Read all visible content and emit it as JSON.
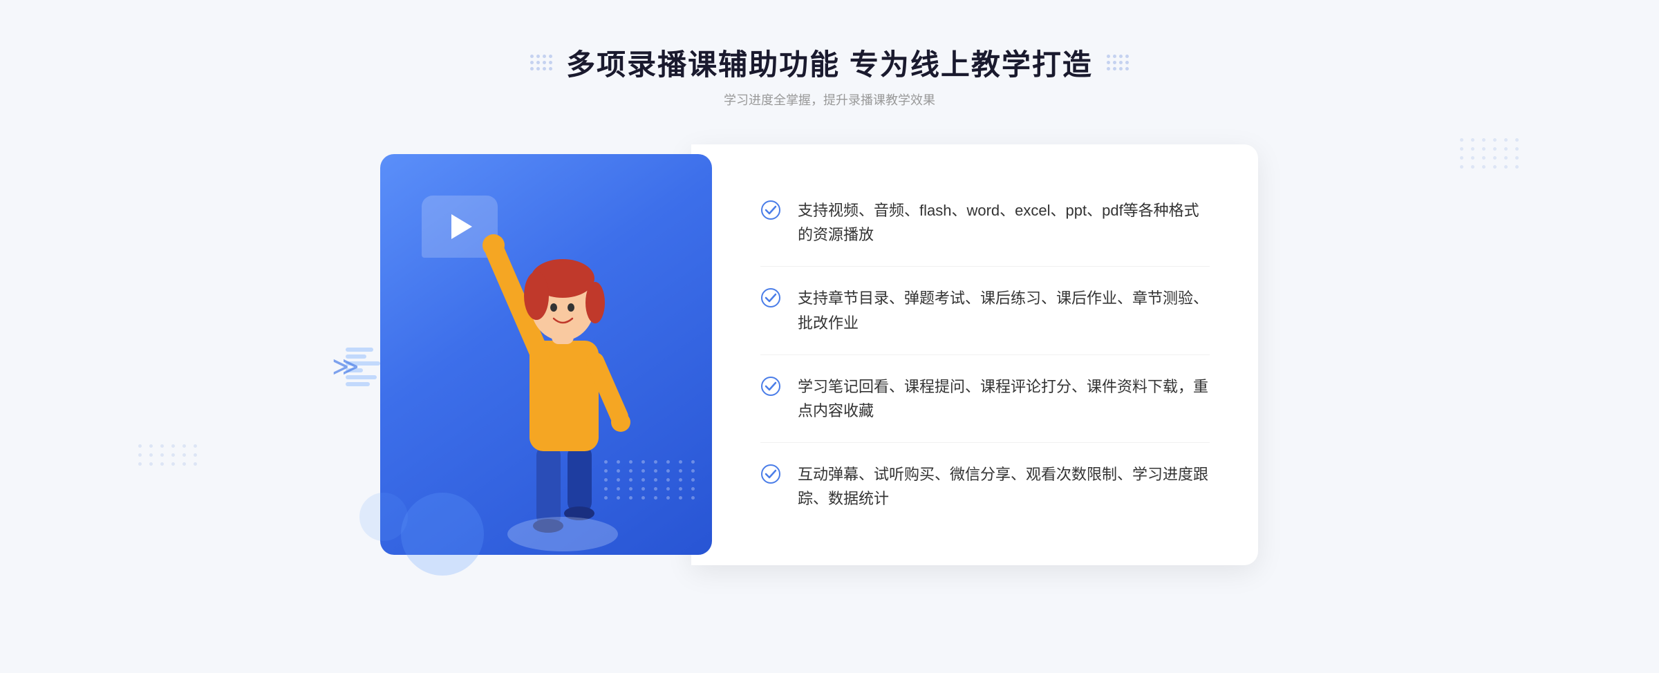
{
  "header": {
    "title": "多项录播课辅助功能 专为线上教学打造",
    "subtitle": "学习进度全掌握，提升录播课教学效果"
  },
  "features": [
    {
      "id": 1,
      "text": "支持视频、音频、flash、word、excel、ppt、pdf等各种格式的资源播放"
    },
    {
      "id": 2,
      "text": "支持章节目录、弹题考试、课后练习、课后作业、章节测验、批改作业"
    },
    {
      "id": 3,
      "text": "学习笔记回看、课程提问、课程评论打分、课件资料下载，重点内容收藏"
    },
    {
      "id": 4,
      "text": "互动弹幕、试听购买、微信分享、观看次数限制、学习进度跟踪、数据统计"
    }
  ],
  "colors": {
    "primary": "#3d6fea",
    "gradient_start": "#5b8ff9",
    "gradient_end": "#2855d4",
    "text_dark": "#1a1a2e",
    "text_gray": "#999999",
    "feature_text": "#333333",
    "check_color": "#4a7de8"
  }
}
